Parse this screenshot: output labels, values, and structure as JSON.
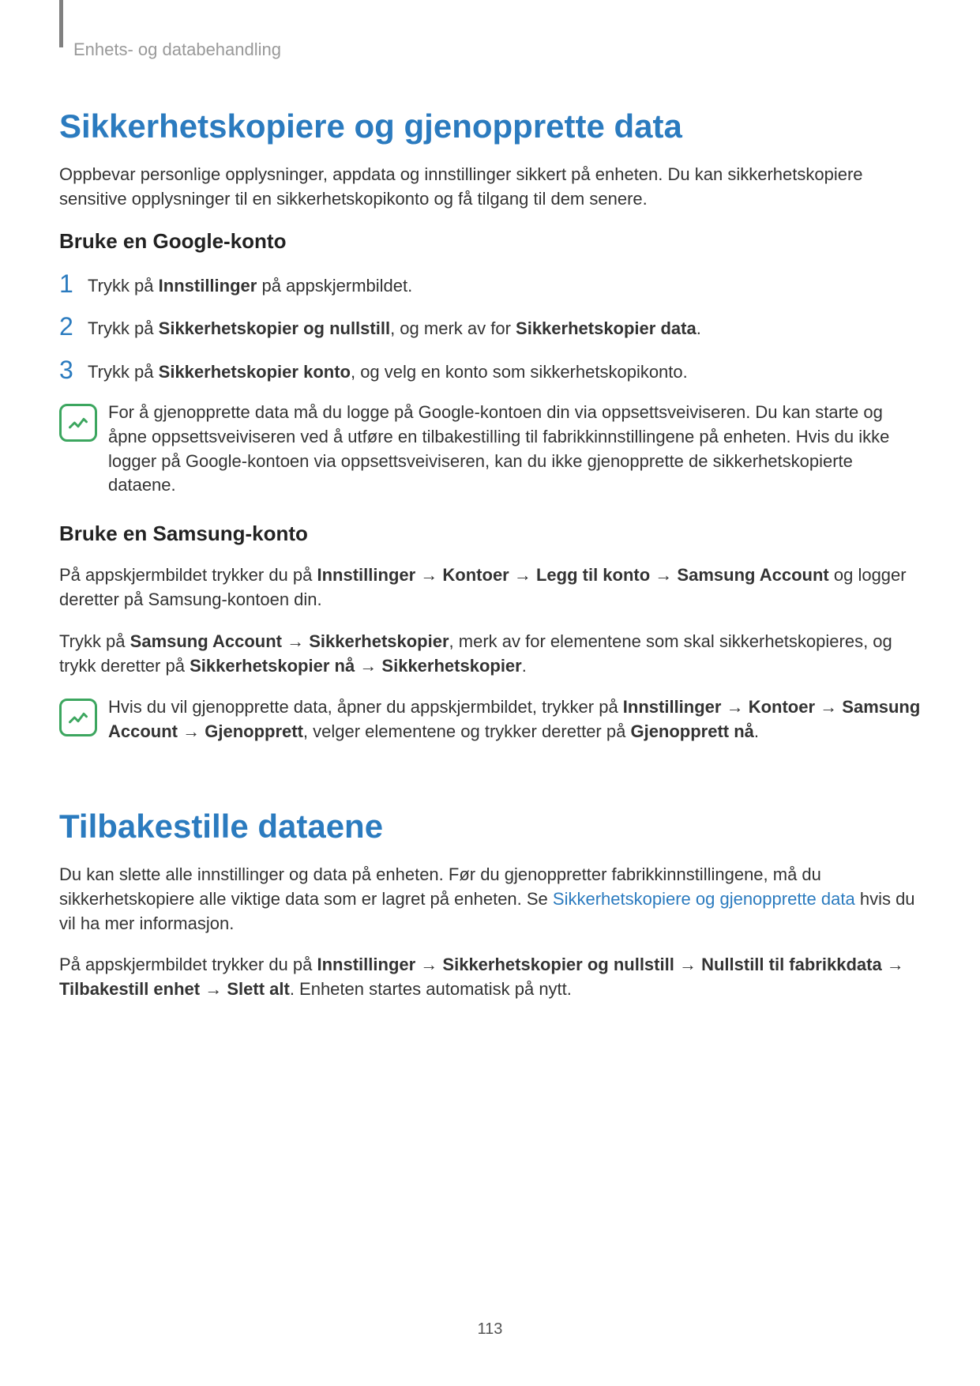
{
  "breadcrumb": "Enhets- og databehandling",
  "section1": {
    "title": "Sikkerhetskopiere og gjenopprette data",
    "intro": "Oppbevar personlige opplysninger, appdata og innstillinger sikkert på enheten. Du kan sikkerhetskopiere sensitive opplysninger til en sikkerhetskopikonto og få tilgang til dem senere.",
    "sub1_title": "Bruke en Google-konto",
    "steps": [
      {
        "n": "1",
        "pre": "Trykk på ",
        "b1": "Innstillinger",
        "post1": " på appskjermbildet."
      },
      {
        "n": "2",
        "pre": "Trykk på ",
        "b1": "Sikkerhetskopier og nullstill",
        "post1": ", og merk av for ",
        "b2": "Sikkerhetskopier data",
        "post2": "."
      },
      {
        "n": "3",
        "pre": "Trykk på ",
        "b1": "Sikkerhetskopier konto",
        "post1": ", og velg en konto som sikkerhetskopikonto."
      }
    ],
    "note1": "For å gjenopprette data må du logge på Google-kontoen din via oppsettsveiviseren. Du kan starte og åpne oppsettsveiviseren ved å utføre en tilbakestilling til fabrikkinnstillingene på enheten. Hvis du ikke logger på Google-kontoen via oppsettsveiviseren, kan du ikke gjenopprette de sikkerhetskopierte dataene.",
    "sub2_title": "Bruke en Samsung-konto",
    "p1": {
      "t1": "På appskjermbildet trykker du på ",
      "b1": "Innstillinger",
      "a1": " → ",
      "b2": "Kontoer",
      "a2": " → ",
      "b3": "Legg til konto",
      "a3": " → ",
      "b4": "Samsung Account",
      "t2": " og logger deretter på Samsung-kontoen din."
    },
    "p2": {
      "t1": "Trykk på ",
      "b1": "Samsung Account",
      "a1": " → ",
      "b2": "Sikkerhetskopier",
      "t2": ", merk av for elementene som skal sikkerhetskopieres, og trykk deretter på ",
      "b3": "Sikkerhetskopier nå",
      "a2": " → ",
      "b4": "Sikkerhetskopier",
      "t3": "."
    },
    "note2": {
      "t1": "Hvis du vil gjenopprette data, åpner du appskjermbildet, trykker på ",
      "b1": "Innstillinger",
      "a1": " → ",
      "b2": "Kontoer",
      "a2": " → ",
      "b3": "Samsung Account",
      "a3": " → ",
      "b4": "Gjenopprett",
      "t2": ", velger elementene og trykker deretter på ",
      "b5": "Gjenopprett nå",
      "t3": "."
    }
  },
  "section2": {
    "title": "Tilbakestille dataene",
    "p1_t1": "Du kan slette alle innstillinger og data på enheten. Før du gjenoppretter fabrikkinnstillingene, må du sikkerhetskopiere alle viktige data som er lagret på enheten. Se ",
    "p1_link": "Sikkerhetskopiere og gjenopprette data",
    "p1_t2": " hvis du vil ha mer informasjon.",
    "p2": {
      "t1": "På appskjermbildet trykker du på ",
      "b1": "Innstillinger",
      "a1": " → ",
      "b2": "Sikkerhetskopier og nullstill",
      "a2": " → ",
      "b3": "Nullstill til fabrikkdata",
      "a3": " → ",
      "b4": "Tilbakestill enhet",
      "a4": " → ",
      "b5": "Slett alt",
      "t2": ". Enheten startes automatisk på nytt."
    }
  },
  "pagenum": "113"
}
